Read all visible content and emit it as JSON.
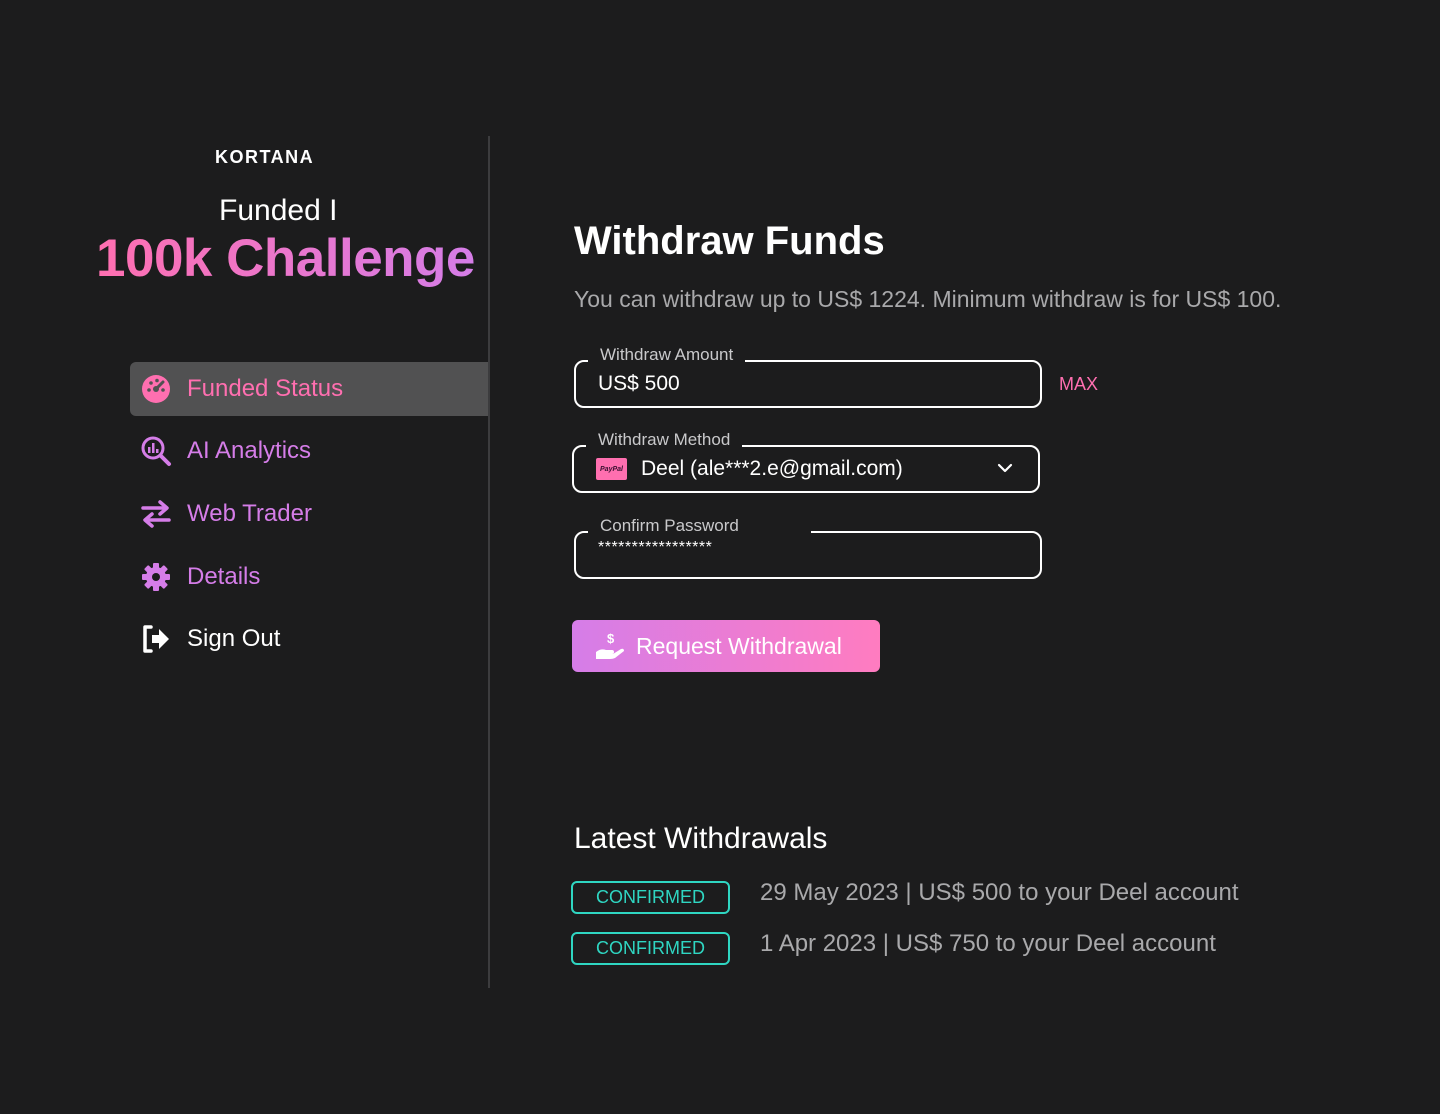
{
  "brand": {
    "logo": "KORTANA",
    "funded_label": "Funded I",
    "challenge_label": "100k Challenge"
  },
  "sidebar": {
    "items": [
      {
        "label": "Funded Status",
        "icon": "dashboard-icon",
        "active": true
      },
      {
        "label": "AI Analytics",
        "icon": "analytics-search-icon"
      },
      {
        "label": "Web Trader",
        "icon": "swap-arrows-icon"
      },
      {
        "label": "Details",
        "icon": "gear-icon"
      },
      {
        "label": "Sign Out",
        "icon": "sign-out-icon"
      }
    ]
  },
  "main": {
    "title": "Withdraw Funds",
    "subtitle": "You can withdraw up to US$ 1224. Minimum withdraw is for US$ 100.",
    "amount": {
      "label": "Withdraw Amount",
      "value": "US$ 500",
      "max_label": "MAX"
    },
    "method": {
      "label": "Withdraw Method",
      "value": "Deel (ale***2.e@gmail.com)",
      "badge_text": "PayPal"
    },
    "password": {
      "label": "Confirm Password",
      "value": "*****************"
    },
    "submit_label": "Request Withdrawal"
  },
  "withdrawals": {
    "title": "Latest Withdrawals",
    "items": [
      {
        "status": "CONFIRMED",
        "text": "29 May 2023 | US$ 500 to your Deel account"
      },
      {
        "status": "CONFIRMED",
        "text": "1 Apr 2023 | US$ 750 to your Deel account"
      }
    ]
  },
  "colors": {
    "background": "#1c1c1d",
    "pink": "#ff6fb0",
    "violet": "#d57de8",
    "teal": "#2fd6c2"
  }
}
